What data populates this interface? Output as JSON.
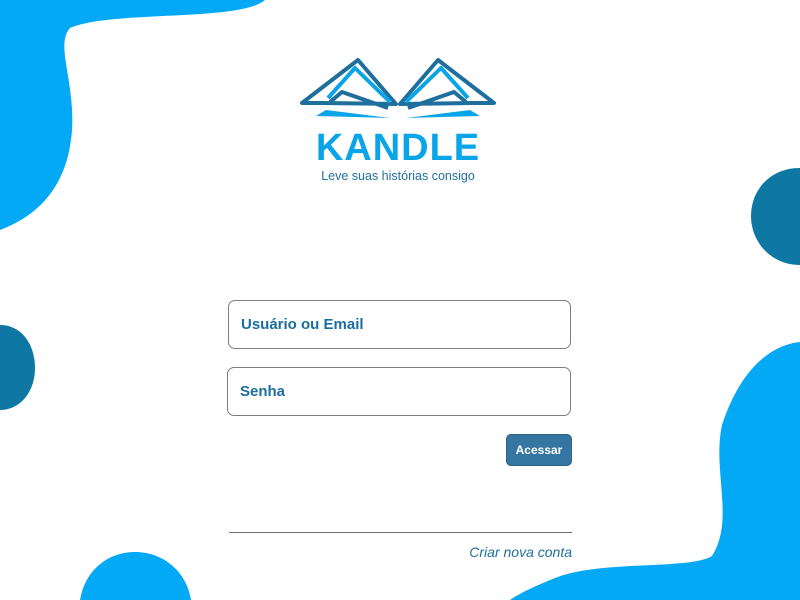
{
  "brand": {
    "name": "KANDLE",
    "tagline": "Leve suas histórias consigo"
  },
  "login_form": {
    "username_placeholder": "Usuário ou Email",
    "password_placeholder": "Senha",
    "submit_label": "Acessar"
  },
  "footer": {
    "create_account_label": "Criar nova conta"
  },
  "colors": {
    "primary_blue": "#03a9f4",
    "dark_blue": "#0f77a3",
    "button": "#3476a1",
    "text_blue": "#1b6fa0"
  },
  "icons": {
    "logo": "open-book-icon"
  }
}
